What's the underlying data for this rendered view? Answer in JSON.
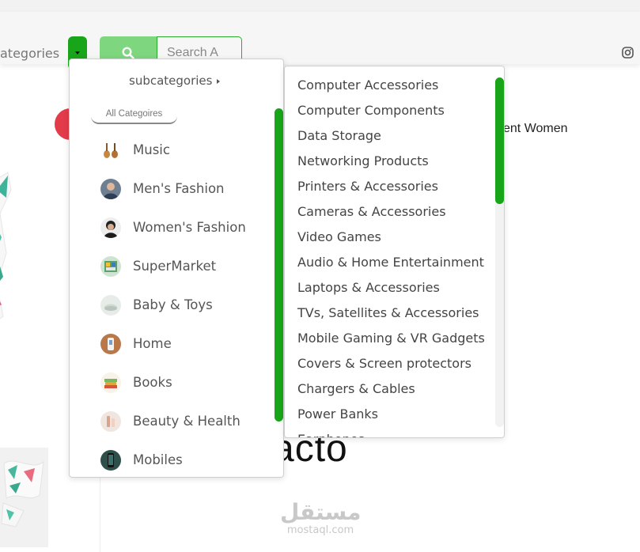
{
  "header": {
    "categories_label": "ategories",
    "search_placeholder": "Search A",
    "accent_color": "#19a519"
  },
  "background": {
    "product_title": "ent Women",
    "logo_text": "acto",
    "watermark_arabic": "مستقل",
    "watermark_latin": "mostaql.com"
  },
  "categories_panel": {
    "heading": "subcategories",
    "all_label": "All Categoires",
    "items": [
      {
        "label": "Music",
        "icon": "music-icon"
      },
      {
        "label": "Men's Fashion",
        "icon": "men-fashion-icon"
      },
      {
        "label": "Women's Fashion",
        "icon": "women-fashion-icon"
      },
      {
        "label": "SuperMarket",
        "icon": "supermarket-icon"
      },
      {
        "label": "Baby & Toys",
        "icon": "baby-toys-icon"
      },
      {
        "label": "Home",
        "icon": "home-icon"
      },
      {
        "label": "Books",
        "icon": "books-icon"
      },
      {
        "label": "Beauty & Health",
        "icon": "beauty-health-icon"
      },
      {
        "label": "Mobiles",
        "icon": "mobiles-icon"
      }
    ]
  },
  "subcategories_panel": {
    "items": [
      "Computer Accessories",
      "Computer Components",
      "Data Storage",
      "Networking Products",
      "Printers & Accessories",
      "Cameras & Accessories",
      "Video Games",
      "Audio & Home Entertainment",
      "Laptops & Accessories",
      "TVs, Satellites & Accessories",
      "Mobile Gaming & VR Gadgets",
      "Covers & Screen protectors",
      "Chargers & Cables",
      "Power Banks",
      "Earphones"
    ]
  }
}
